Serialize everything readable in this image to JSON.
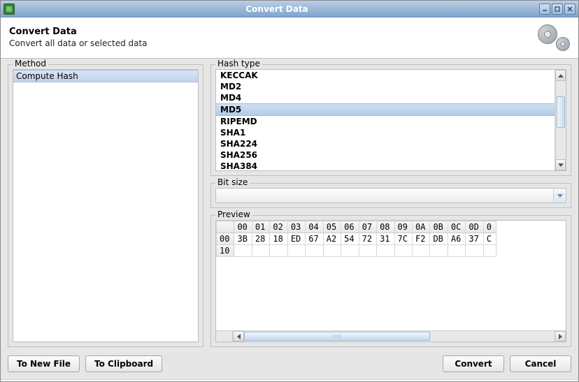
{
  "window": {
    "title": "Convert Data"
  },
  "header": {
    "title": "Convert Data",
    "subtitle": "Convert all data or selected data"
  },
  "method": {
    "legend": "Method",
    "items": [
      "Compute Hash"
    ],
    "selected_index": 0
  },
  "hash_type": {
    "legend": "Hash type",
    "items": [
      "KECCAK",
      "MD2",
      "MD4",
      "MD5",
      "RIPEMD",
      "SHA1",
      "SHA224",
      "SHA256",
      "SHA384"
    ],
    "selected_index": 3
  },
  "bit_size": {
    "legend": "Bit size",
    "value": ""
  },
  "preview": {
    "legend": "Preview",
    "columns": [
      "00",
      "01",
      "02",
      "03",
      "04",
      "05",
      "06",
      "07",
      "08",
      "09",
      "0A",
      "0B",
      "0C",
      "0D",
      "0"
    ],
    "rows": [
      {
        "offset": "00",
        "cells": [
          "3B",
          "28",
          "18",
          "ED",
          "67",
          "A2",
          "54",
          "72",
          "31",
          "7C",
          "F2",
          "DB",
          "A6",
          "37",
          "C"
        ]
      },
      {
        "offset": "10",
        "cells": [
          "",
          "",
          "",
          "",
          "",
          "",
          "",
          "",
          "",
          "",
          "",
          "",
          "",
          "",
          ""
        ]
      }
    ]
  },
  "buttons": {
    "to_new_file": "To New File",
    "to_clipboard": "To Clipboard",
    "convert": "Convert",
    "cancel": "Cancel"
  }
}
